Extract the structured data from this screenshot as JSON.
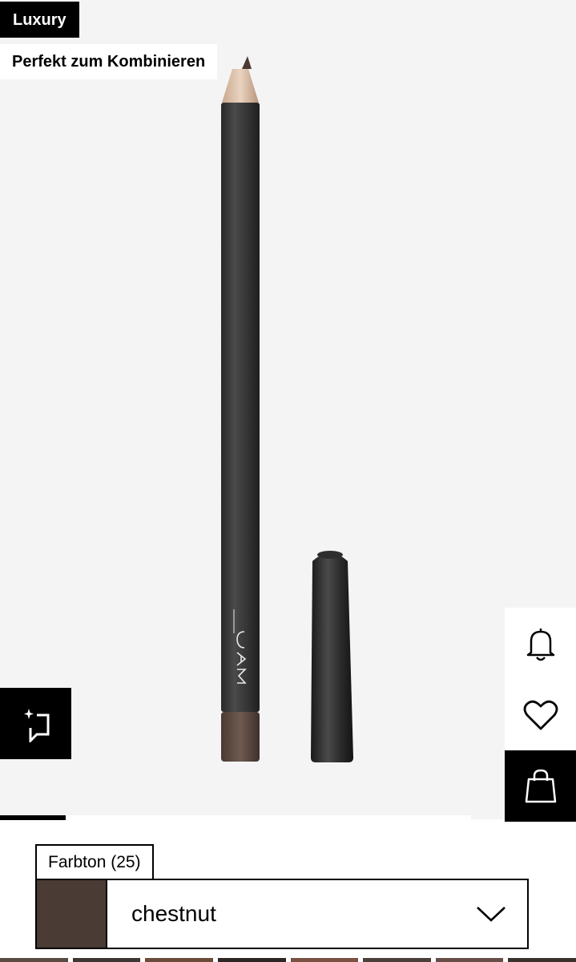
{
  "badges": {
    "luxury": "Luxury",
    "combine": "Perfekt zum Kombinieren"
  },
  "product": {
    "brand_mark": "MAC",
    "pencil_color": "#5b4a42"
  },
  "actions": {
    "bell_icon": "bell-icon",
    "heart_icon": "heart-icon",
    "bag_icon": "shopping-bag-icon",
    "ai_icon": "sparkle-chat-icon"
  },
  "gallery": {
    "progress": 0.14
  },
  "shade": {
    "tab_label": "Farbton (25)",
    "selected_name": "chestnut",
    "selected_color": "#4a3b35"
  },
  "swatch_row": [
    "#5a4a42",
    "#3e3633",
    "#6b4c3b",
    "#2c2624",
    "#7a5143",
    "#4b3f3a",
    "#664f47",
    "#3a302c"
  ]
}
